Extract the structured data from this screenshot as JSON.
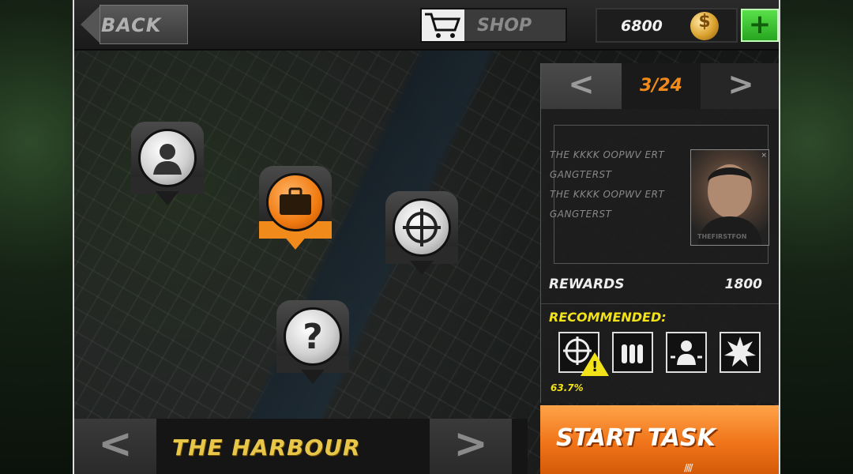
{
  "header": {
    "back_label": "BACK",
    "shop_label": "SHOP",
    "coins": "6800",
    "coin_symbol": "$",
    "add_label": "+"
  },
  "map_pins": [
    {
      "icon": "person-icon",
      "state": "normal"
    },
    {
      "icon": "briefcase-icon",
      "state": "selected"
    },
    {
      "icon": "crosshair-icon",
      "state": "normal"
    },
    {
      "icon": "question-icon",
      "glyph": "?",
      "state": "normal"
    }
  ],
  "mission_panel": {
    "pager": {
      "prev": "<",
      "page": "3/24",
      "next": ">"
    },
    "briefing_lines": [
      "THE KKKK  OOPWV ERT",
      "GANGTERST",
      "THE KKKK  OOPWV ERT",
      "GANGTERST"
    ],
    "portrait_watermark": "THEFIRSTFON",
    "portrait_close": "×",
    "rewards_label": "REWARDS",
    "rewards_value": "1800",
    "recommended_label": "RECOMMENDED:",
    "recommended_items": [
      {
        "icon": "crosshair-icon",
        "warning": true
      },
      {
        "icon": "ammo-icon"
      },
      {
        "icon": "target-person-icon"
      },
      {
        "icon": "explosion-icon"
      }
    ],
    "warning_glyph": "!",
    "accuracy": "63.7%"
  },
  "start_task_label": "START TASK",
  "start_task_stripes": "////",
  "region": {
    "prev": "<",
    "name": "THE HARBOUR",
    "next": ">"
  },
  "colors": {
    "accent_orange": "#f08a1a",
    "accent_yellow": "#f2e21a",
    "region_gold": "#e8c64a",
    "add_green": "#3fcc33"
  }
}
